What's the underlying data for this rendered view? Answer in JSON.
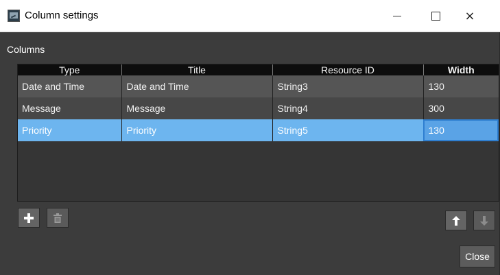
{
  "window": {
    "title": "Column settings",
    "icon": "app-icon",
    "controls": {
      "minimize": "minimize-icon",
      "maximize": "maximize-icon",
      "close": "×"
    }
  },
  "section_label": "Columns",
  "grid": {
    "headers": [
      "Type",
      "Title",
      "Resource ID",
      "Width"
    ],
    "rows": [
      {
        "type": "Date and Time",
        "title": "Date and Time",
        "resource_id": "String3",
        "width": "130"
      },
      {
        "type": "Message",
        "title": "Message",
        "resource_id": "String4",
        "width": "300"
      },
      {
        "type": "Priority",
        "title": "Priority",
        "resource_id": "String5",
        "width": "130"
      }
    ],
    "selected_row": 2
  },
  "toolbar": {
    "add_icon": "plus-icon",
    "delete_icon": "trash-icon",
    "move_up_icon": "arrow-up-icon",
    "move_down_icon": "arrow-down-icon"
  },
  "close_button": "Close",
  "colors": {
    "titlebar": "#ffffff",
    "background": "#3c3c3c",
    "grid_header": "#0d0d0d",
    "row_a": "#555555",
    "row_b": "#474747",
    "selection": "#6db5ef",
    "selection_focus_border": "#2f7fd1"
  }
}
